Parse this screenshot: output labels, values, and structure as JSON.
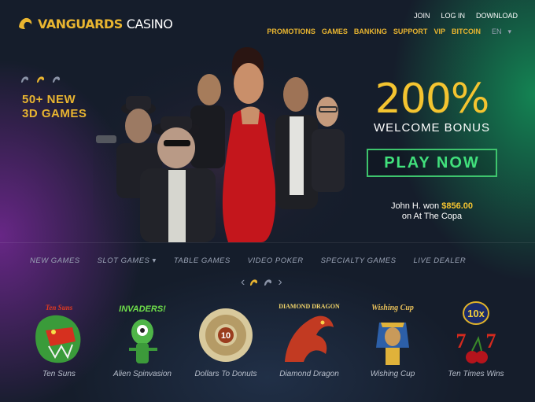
{
  "brand": {
    "name_bold": "VANGUARDS",
    "name_light": "CASINO"
  },
  "top_links": [
    "JOIN",
    "LOG IN",
    "DOWNLOAD"
  ],
  "main_nav": [
    "PROMOTIONS",
    "GAMES",
    "BANKING",
    "SUPPORT",
    "VIP",
    "BITCOIN"
  ],
  "language": {
    "selected": "EN"
  },
  "hero": {
    "promo_line1": "50+ NEW",
    "promo_line2": "3D GAMES",
    "bonus_amount": "200%",
    "bonus_label": "WELCOME BONUS",
    "cta_label": "PLAY NOW",
    "winner_prefix": "John H. won ",
    "winner_amount": "$856.00",
    "winner_suffix": "on At The Copa"
  },
  "categories": [
    "NEW GAMES",
    "SLOT GAMES",
    "TABLE GAMES",
    "VIDEO POKER",
    "SPECIALTY GAMES",
    "LIVE DEALER"
  ],
  "games": [
    {
      "name": "Ten Suns",
      "thumb_title": "Ten Suns",
      "color": "#d6301f"
    },
    {
      "name": "Alien Spinvasion",
      "thumb_title": "INVADERS!",
      "color": "#3fa83b"
    },
    {
      "name": "Dollars To Donuts",
      "thumb_title": "10",
      "color": "#c9b98a"
    },
    {
      "name": "Diamond Dragon",
      "thumb_title": "DIAMOND DRAGON",
      "color": "#c23a22"
    },
    {
      "name": "Wishing Cup",
      "thumb_title": "Wishing Cup",
      "color": "#d9a93a"
    },
    {
      "name": "Ten Times Wins",
      "thumb_title": "10x",
      "color": "#e0b22a"
    }
  ],
  "colors": {
    "gold": "#e9b530",
    "green": "#41e07c",
    "bg": "#151d2b"
  }
}
